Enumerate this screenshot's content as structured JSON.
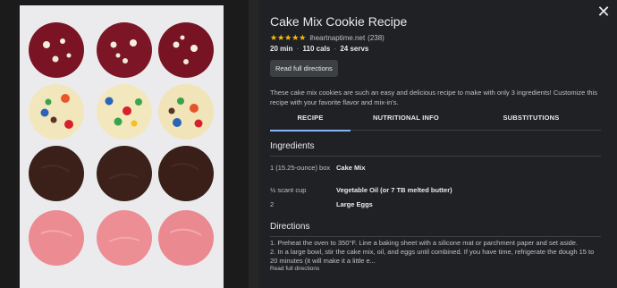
{
  "recipe": {
    "title": "Cake Mix Cookie Recipe",
    "stars": "★★★★★",
    "source": "iheartnaptime.net",
    "review_count": "(238)",
    "time": "20 min",
    "calories": "110 cals",
    "servings": "24 servs",
    "separator": "·",
    "read_full_button": "Read full directions",
    "description": "These cake mix cookies are such an easy and delicious recipe to make with only 3 ingredients! Customize this recipe with your favorite flavor and mix-in's."
  },
  "tabs": [
    {
      "label": "RECIPE",
      "active": true
    },
    {
      "label": "NUTRITIONAL INFO",
      "active": false
    },
    {
      "label": "SUBSTITUTIONS",
      "active": false
    }
  ],
  "ingredients": {
    "heading": "Ingredients",
    "items": [
      {
        "qty": "1 (15.25-ounce) box",
        "name": "Cake Mix"
      },
      {
        "qty": "½ scant cup",
        "name": "Vegetable Oil (or 7 TB melted butter)"
      },
      {
        "qty": "2",
        "name": "Large Eggs"
      }
    ]
  },
  "directions": {
    "heading": "Directions",
    "step1": "1. Preheat the oven to 350°F. Line a baking sheet with a silicone mat or parchment paper and set aside.",
    "step2": "2. In a large bowl, stir the cake mix, oil, and eggs until combined. If you have time, refrigerate the dough 15 to 20 minutes (it will make it a little e...",
    "read_full_link": "Read full directions"
  },
  "colors": {
    "star": "#fbbc04",
    "tab_indicator": "#8ab4f8",
    "panel_bg": "#202124"
  },
  "icons": {
    "close": "close-icon"
  }
}
